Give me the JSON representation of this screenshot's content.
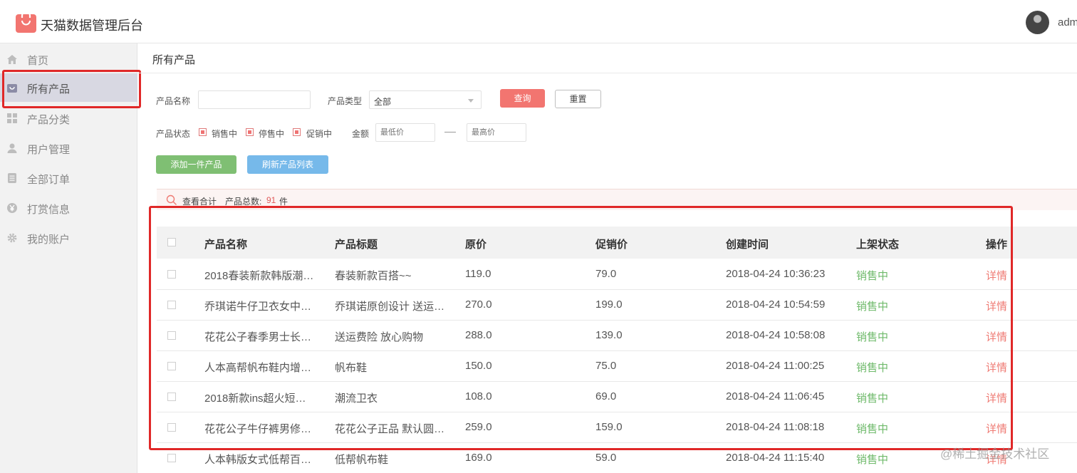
{
  "header": {
    "app_title": "天猫数据管理后台",
    "username": "adm"
  },
  "sidebar": {
    "items": [
      {
        "label": "首页",
        "icon": "home-icon"
      },
      {
        "label": "所有产品",
        "icon": "bag-icon",
        "active": true
      },
      {
        "label": "产品分类",
        "icon": "grid-icon"
      },
      {
        "label": "用户管理",
        "icon": "user-icon"
      },
      {
        "label": "全部订单",
        "icon": "list-icon"
      },
      {
        "label": "打赏信息",
        "icon": "yen-icon"
      },
      {
        "label": "我的账户",
        "icon": "gear-icon"
      }
    ]
  },
  "breadcrumb": "所有产品",
  "filters": {
    "name_label": "产品名称",
    "name_value": "",
    "type_label": "产品类型",
    "type_value": "全部",
    "query_button": "查询",
    "reset_button": "重置",
    "status_label": "产品状态",
    "status_options": [
      "销售中",
      "停售中",
      "促销中"
    ],
    "amount_label": "金额",
    "min_placeholder": "最低价",
    "max_placeholder": "最高价"
  },
  "actions": {
    "add_button": "添加一件产品",
    "refresh_button": "刷新产品列表"
  },
  "summary": {
    "label": "查看合计",
    "count_label": "产品总数:",
    "count": "91",
    "unit": "件"
  },
  "table": {
    "headers": [
      "产品名称",
      "产品标题",
      "原价",
      "促销价",
      "创建时间",
      "上架状态",
      "操作"
    ],
    "rows": [
      {
        "name": "2018春装新款韩版潮…",
        "title": "春装新款百搭~~",
        "price": "119.0",
        "promo": "79.0",
        "created": "2018-04-24 10:36:23",
        "status": "销售中",
        "action": "详情"
      },
      {
        "name": "乔琪诺牛仔卫衣女中…",
        "title": "乔琪诺原创设计 送运…",
        "price": "270.0",
        "promo": "199.0",
        "created": "2018-04-24 10:54:59",
        "status": "销售中",
        "action": "详情"
      },
      {
        "name": "花花公子春季男士长…",
        "title": "送运费险 放心购物",
        "price": "288.0",
        "promo": "139.0",
        "created": "2018-04-24 10:58:08",
        "status": "销售中",
        "action": "详情"
      },
      {
        "name": "人本高帮帆布鞋内增…",
        "title": "帆布鞋",
        "price": "150.0",
        "promo": "75.0",
        "created": "2018-04-24 11:00:25",
        "status": "销售中",
        "action": "详情"
      },
      {
        "name": "2018新款ins超火短…",
        "title": "潮流卫衣",
        "price": "108.0",
        "promo": "69.0",
        "created": "2018-04-24 11:06:45",
        "status": "销售中",
        "action": "详情"
      },
      {
        "name": "花花公子牛仔裤男修…",
        "title": "花花公子正品 默认圆…",
        "price": "259.0",
        "promo": "159.0",
        "created": "2018-04-24 11:08:18",
        "status": "销售中",
        "action": "详情"
      },
      {
        "name": "人本韩版女式低帮百…",
        "title": "低帮帆布鞋",
        "price": "169.0",
        "promo": "59.0",
        "created": "2018-04-24 11:15:40",
        "status": "销售中",
        "action": "详情"
      }
    ]
  },
  "watermark": "@稀土掘金技术社区",
  "colors": {
    "accent": "#f27570",
    "status_green": "#6fba6b",
    "highlight": "#e02828"
  }
}
